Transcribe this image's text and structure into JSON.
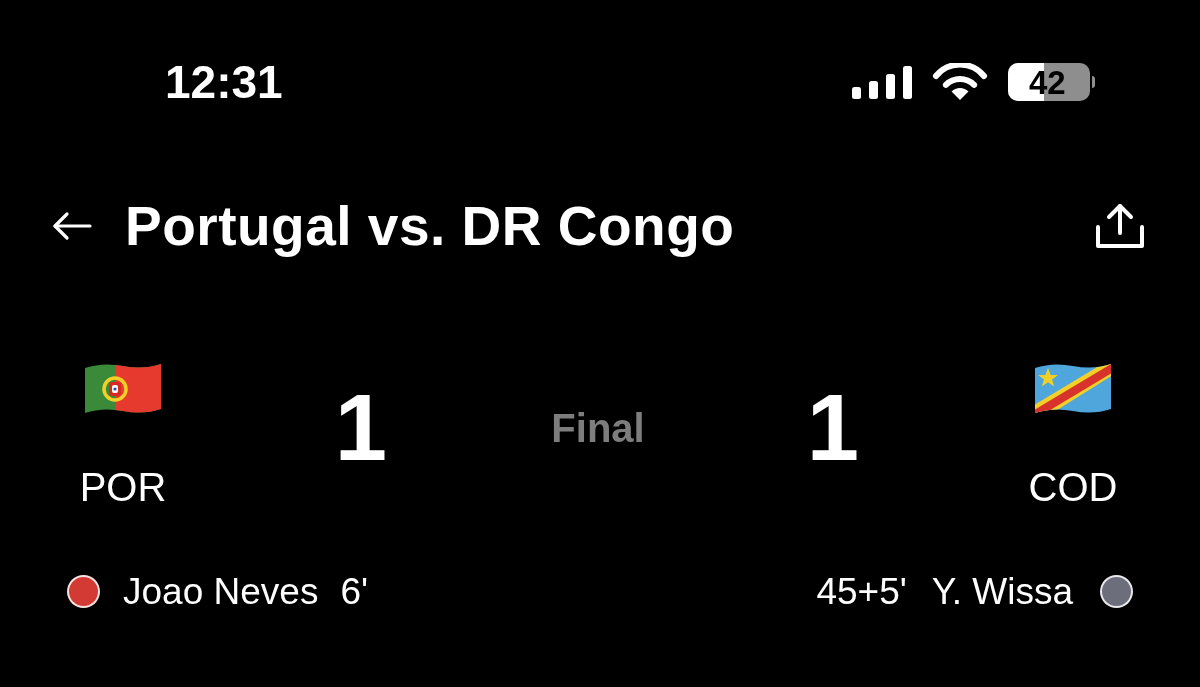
{
  "status_bar": {
    "time": "12:31",
    "battery": "42"
  },
  "header": {
    "title": "Portugal vs. DR Congo"
  },
  "match": {
    "status": "Final",
    "teams": [
      {
        "code": "POR",
        "score": "1",
        "goals": [
          {
            "player": "Joao Neves",
            "minute": "6'",
            "color": "#d33a34"
          }
        ]
      },
      {
        "code": "COD",
        "score": "1",
        "goals": [
          {
            "player": "Y. Wissa",
            "minute": "45+5'",
            "color": "#6c6f7b"
          }
        ]
      }
    ]
  }
}
